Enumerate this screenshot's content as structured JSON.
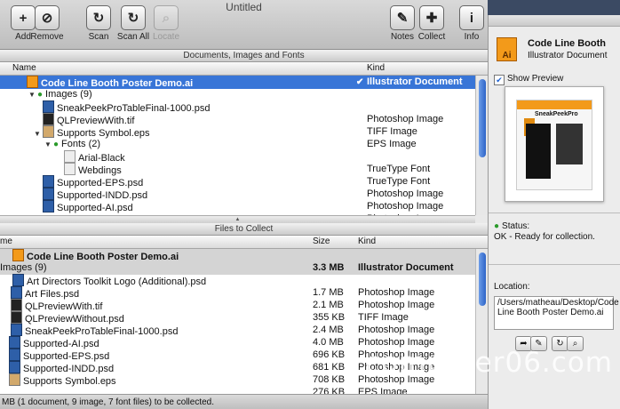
{
  "window": {
    "title": "Untitled"
  },
  "toolbar": [
    {
      "label": "Add",
      "icon": "add-icon",
      "glyph": "+",
      "enabled": true
    },
    {
      "label": "Remove",
      "icon": "remove-icon",
      "glyph": "⊘",
      "enabled": true
    },
    {
      "label": "Scan",
      "icon": "scan-icon",
      "glyph": "↻",
      "enabled": true
    },
    {
      "label": "Scan All",
      "icon": "scan-all-icon",
      "glyph": "↻",
      "enabled": true
    },
    {
      "label": "Locate",
      "icon": "locate-icon",
      "glyph": "⌕",
      "enabled": false
    },
    {
      "label": "Notes",
      "icon": "notes-icon",
      "glyph": "✎",
      "enabled": true
    },
    {
      "label": "Collect",
      "icon": "collect-icon",
      "glyph": "✚",
      "enabled": true
    },
    {
      "label": "Info",
      "icon": "info-icon",
      "glyph": "i",
      "enabled": true
    }
  ],
  "documents": {
    "section_title": "Documents, Images and Fonts",
    "columns": {
      "name": "Name",
      "kind": "Kind"
    },
    "rows": [
      {
        "name": "Code Line Booth Poster Demo.ai",
        "kind": "Illustrator Document"
      },
      {
        "name": "Images (9)",
        "kind": ""
      },
      {
        "name": "SneakPeekProTableFinal-1000.psd",
        "kind": ""
      },
      {
        "name": "QLPreviewWith.tif",
        "kind": "Photoshop Image"
      },
      {
        "name": "Supports Symbol.eps",
        "kind": "TIFF Image"
      },
      {
        "name": "Fonts (2)",
        "kind": "EPS Image"
      },
      {
        "name": "Arial-Black",
        "kind": ""
      },
      {
        "name": "Webdings",
        "kind": "TrueType Font"
      },
      {
        "name": "Supported-EPS.psd",
        "kind": "TrueType Font"
      },
      {
        "name": "Supported-INDD.psd",
        "kind": "Photoshop Image"
      },
      {
        "name": "Supported-AI.psd",
        "kind": "Photoshop Image"
      },
      {
        "name": "",
        "kind": "Photoshop Image"
      }
    ]
  },
  "collect": {
    "section_title": "Files to Collect",
    "columns": {
      "name": "me",
      "size": "Size",
      "kind": "Kind"
    },
    "rows": [
      {
        "name": "Code Line Booth Poster Demo.ai",
        "size": "",
        "kind": ""
      },
      {
        "name": "Images (9)",
        "size": "3.3 MB",
        "kind": "Illustrator Document"
      },
      {
        "name": "Art Directors Toolkit Logo (Additional).psd",
        "size": "",
        "kind": ""
      },
      {
        "name": "Art Files.psd",
        "size": "1.7 MB",
        "kind": "Photoshop Image"
      },
      {
        "name": "QLPreviewWith.tif",
        "size": "2.1 MB",
        "kind": "Photoshop Image"
      },
      {
        "name": "QLPreviewWithout.psd",
        "size": "355 KB",
        "kind": "TIFF Image"
      },
      {
        "name": "SneakPeekProTableFinal-1000.psd",
        "size": "2.4 MB",
        "kind": "Photoshop Image"
      },
      {
        "name": "Supported-AI.psd",
        "size": "4.0 MB",
        "kind": "Photoshop Image"
      },
      {
        "name": "Supported-EPS.psd",
        "size": "696 KB",
        "kind": "Photoshop Image"
      },
      {
        "name": "Supported-INDD.psd",
        "size": "681 KB",
        "kind": "Photoshop Image"
      },
      {
        "name": "Supports Symbol.eps",
        "size": "708 KB",
        "kind": "Photoshop Image"
      },
      {
        "name": "",
        "size": "276 KB",
        "kind": "EPS Image"
      }
    ]
  },
  "statusbar": {
    "text": "MB (1 document, 9 image, 7 font files) to be collected."
  },
  "info_panel": {
    "doc_title": "Code Line Booth",
    "doc_type": "Illustrator Document",
    "show_preview_label": "Show Preview",
    "preview_title": "SneakPeekPro",
    "status_label": "Status:",
    "status_value": "OK - Ready for collection.",
    "location_label": "Location:",
    "location_value": "/Users/matheau/Desktop/Code Line Booth Poster Demo.ai"
  },
  "watermark": "computer06.com",
  "colors": {
    "selection": "#3875d7",
    "accent": "#f39a1a"
  }
}
